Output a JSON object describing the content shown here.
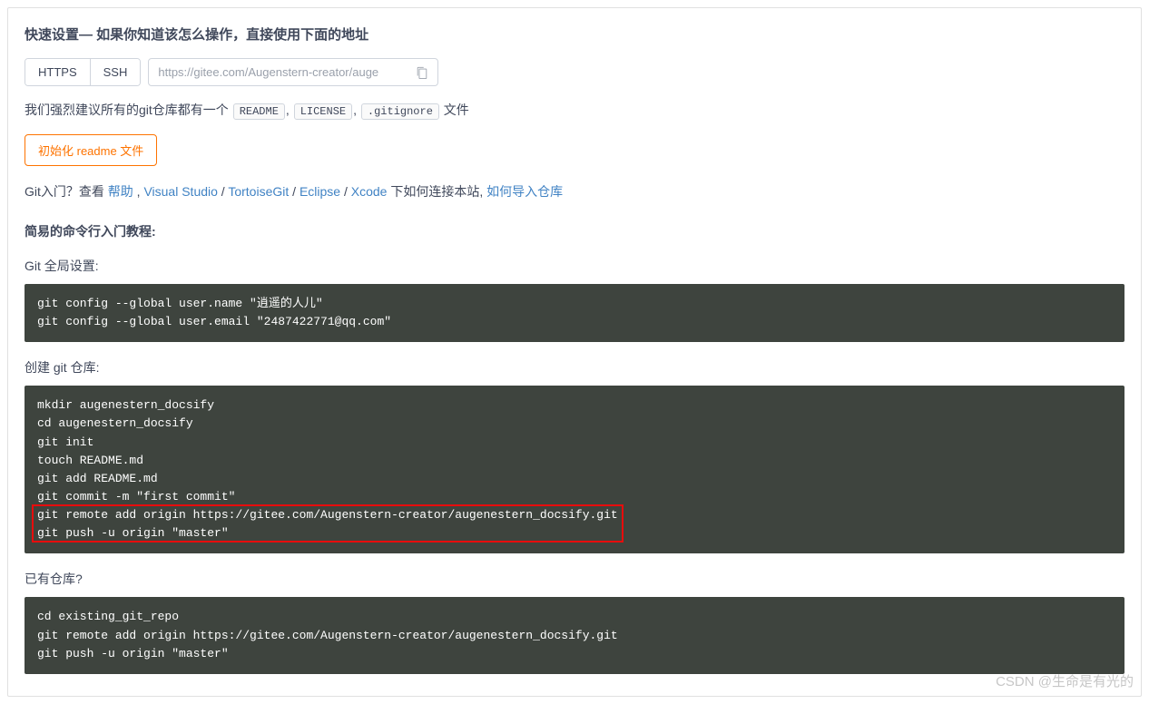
{
  "header": {
    "title": "快速设置— 如果你知道该怎么操作，直接使用下面的地址"
  },
  "protocol": {
    "https": "HTTPS",
    "ssh": "SSH",
    "url": "https://gitee.com/Augenstern-creator/auge"
  },
  "recommend": {
    "prefix": "我们强烈建议所有的git仓库都有一个",
    "readme": "README",
    "comma": ",",
    "license": "LICENSE",
    "gitignore": ".gitignore",
    "suffix": " 文件"
  },
  "init_btn": "初始化 readme 文件",
  "help": {
    "prefix": "Git入门？查看 ",
    "help_link": "帮助",
    "sep1": " , ",
    "vs": "Visual Studio",
    "slash": " / ",
    "tortoise": "TortoiseGit",
    "eclipse": "Eclipse",
    "xcode": "Xcode",
    "mid": " 下如何连接本站, ",
    "import": "如何导入仓库"
  },
  "tutorial": {
    "title": "简易的命令行入门教程:",
    "global_label": "Git 全局设置:",
    "global_code": "git config --global user.name \"逍遥的人儿\"\ngit config --global user.email \"2487422771@qq.com\"",
    "create_label": "创建 git 仓库:",
    "create_code": "mkdir augenestern_docsify\ncd augenestern_docsify\ngit init\ntouch README.md\ngit add README.md\ngit commit -m \"first commit\"\ngit remote add origin https://gitee.com/Augenstern-creator/augenestern_docsify.git\ngit push -u origin \"master\"",
    "exist_label": "已有仓库?",
    "exist_code": "cd existing_git_repo\ngit remote add origin https://gitee.com/Augenstern-creator/augenestern_docsify.git\ngit push -u origin \"master\""
  },
  "watermark": "CSDN @生命是有光的"
}
